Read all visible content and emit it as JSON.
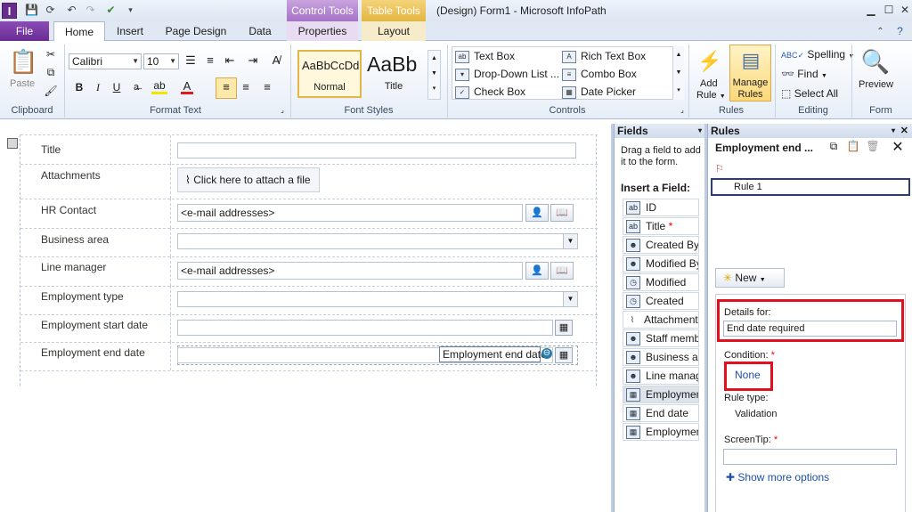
{
  "window": {
    "title": "(Design) Form1 - Microsoft InfoPath",
    "app_icon_letter": "I",
    "contextual_tabs": {
      "control_tools": "Control Tools",
      "table_tools": "Table Tools"
    }
  },
  "tabs": [
    "File",
    "Home",
    "Insert",
    "Page Design",
    "Data",
    "Properties",
    "Layout"
  ],
  "ribbon": {
    "clipboard": {
      "label": "Clipboard",
      "paste": "Paste"
    },
    "format_text": {
      "label": "Format Text",
      "font": "Calibri",
      "size": "10",
      "bold": "B",
      "italic": "I",
      "underline": "U"
    },
    "font_styles": {
      "label": "Font Styles",
      "normal_sample": "AaBbCcDd",
      "normal": "Normal",
      "title_sample": "AaBb",
      "title": "Title"
    },
    "controls": {
      "label": "Controls",
      "items": [
        "Text Box",
        "Rich Text Box",
        "Drop-Down List ...",
        "Combo Box",
        "Check Box",
        "Date Picker"
      ]
    },
    "rules": {
      "label": "Rules",
      "add_rule": "Add",
      "add_rule2": "Rule",
      "manage": "Manage",
      "manage2": "Rules"
    },
    "editing": {
      "label": "Editing",
      "spelling": "Spelling",
      "find": "Find",
      "select_all": "Select All"
    },
    "form": {
      "label": "Form",
      "preview": "Preview"
    }
  },
  "form": {
    "rows": [
      {
        "label": "Title"
      },
      {
        "label": "Attachments",
        "attach": "Click here to attach a file"
      },
      {
        "label": "HR Contact",
        "value": "<e-mail addresses>"
      },
      {
        "label": "Business area"
      },
      {
        "label": "Line manager",
        "value": "<e-mail addresses>"
      },
      {
        "label": "Employment type"
      },
      {
        "label": "Employment start date"
      },
      {
        "label": "Employment end date",
        "tag": "Employment end date"
      }
    ]
  },
  "fields_pane": {
    "title": "Fields",
    "hint": "Drag a field to add it to the form.",
    "insert_label": "Insert a Field:",
    "items": [
      "ID",
      "Title",
      "Created By",
      "Modified By",
      "Modified",
      "Created",
      "Attachments",
      "Staff membe",
      "Business are",
      "Line manage",
      "Employment",
      "End date",
      "Employment"
    ]
  },
  "rules_pane": {
    "title": "Rules",
    "subject": "Employment end ...",
    "rule_item": "Rule 1",
    "new_button": "New",
    "details_for_label": "Details for:",
    "details_for_value": "End date required",
    "condition_label": "Condition:",
    "condition_value": "None",
    "rule_type_label": "Rule type:",
    "rule_type_value": "Validation",
    "screentip_label": "ScreenTip:",
    "show_more": "Show more options"
  }
}
